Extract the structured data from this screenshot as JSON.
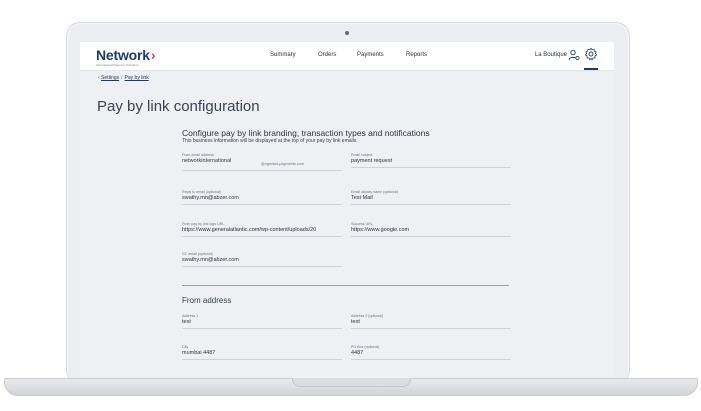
{
  "header": {
    "logo": "Network",
    "logo_sub": "International Payment Solutions",
    "nav": [
      "Summary",
      "Orders",
      "Payments",
      "Reports"
    ],
    "store": "La Boutique"
  },
  "breadcrumb": {
    "root": "Settings",
    "current": "Pay by link"
  },
  "page": {
    "title": "Pay by link configuration"
  },
  "section": {
    "title": "Configure pay by link branding, transaction types and notifications",
    "description": "This business information will be displayed at the top of your pay by link emails."
  },
  "fields": {
    "from_email": {
      "label": "From email address",
      "value": "networkinternational",
      "suffix": "@ngenius-payments.com"
    },
    "email_subject": {
      "label": "Email subject",
      "value": "payment request"
    },
    "reply_to": {
      "label": "Reply to email (optional)",
      "value": "swathy.mn@abzer.com"
    },
    "display_name": {
      "label": "Email display name (optional)",
      "value": "Test Mail"
    },
    "logo_url": {
      "label": "From pay by link logo URL",
      "value": "https://www.generalatlantic.com/wp-content/uploads/20"
    },
    "success_url": {
      "label": "Success URL",
      "value": "https://www.google.com"
    },
    "cc_email": {
      "label": "CC email (optional)",
      "value": "swathy.mn@abzer.com"
    }
  },
  "from_address": {
    "title": "From address",
    "address1": {
      "label": "Address 1",
      "value": "test"
    },
    "address2": {
      "label": "Address 2 (optional)",
      "value": "test"
    },
    "city": {
      "label": "City",
      "value": "mumbai 4487"
    },
    "po_box": {
      "label": "PO Box (optional)",
      "value": "4487"
    }
  },
  "colors": {
    "brand": "#1f3b6b",
    "accent": "#e0443c",
    "background": "#eef0f4"
  }
}
